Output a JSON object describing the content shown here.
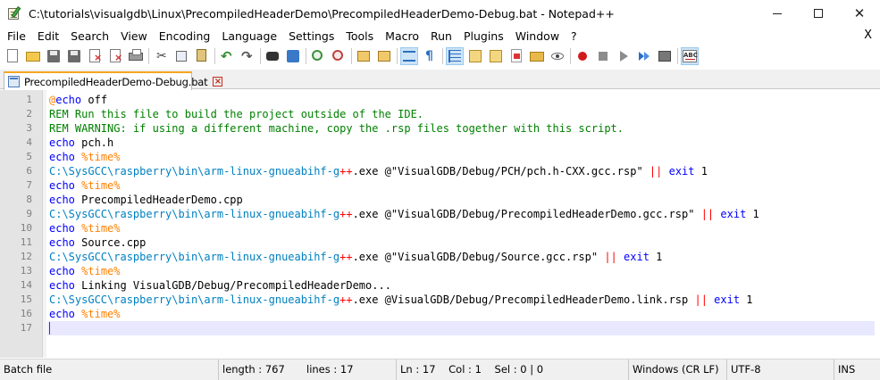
{
  "window": {
    "title": "C:\\tutorials\\visualgdb\\Linux\\PrecompiledHeaderDemo\\PrecompiledHeaderDemo-Debug.bat - Notepad++",
    "minimize": "",
    "close_glyph": "✕",
    "menu_close_glyph": "X"
  },
  "menu": [
    "File",
    "Edit",
    "Search",
    "View",
    "Encoding",
    "Language",
    "Settings",
    "Tools",
    "Macro",
    "Run",
    "Plugins",
    "Window",
    "?"
  ],
  "toolbar": {
    "icons": [
      "new-file-icon",
      "open-file-icon",
      "save-icon",
      "save-all-icon",
      "close-file-icon",
      "close-all-icon",
      "print-icon",
      "cut-icon",
      "copy-icon",
      "paste-icon",
      "undo-icon",
      "redo-icon",
      "find-icon",
      "replace-icon",
      "zoom-in-icon",
      "zoom-out-icon",
      "sync-vertical-icon",
      "sync-horizontal-icon",
      "word-wrap-icon",
      "show-all-characters-icon",
      "indent-guide-icon",
      "user-defined-language-icon",
      "document-map-icon",
      "function-list-icon",
      "folder-as-workspace-icon",
      "monitoring-icon",
      "record-macro-icon",
      "stop-recording-icon",
      "playback-macro-icon",
      "run-macro-multiple-icon",
      "save-macro-icon",
      "spell-check-icon"
    ],
    "abc_text": "ABC"
  },
  "tab": {
    "label": "PrecompiledHeaderDemo-Debug.bat",
    "close_glyph": "×"
  },
  "editor": {
    "line_numbers": [
      "1",
      "2",
      "3",
      "4",
      "5",
      "6",
      "7",
      "8",
      "9",
      "10",
      "11",
      "12",
      "13",
      "14",
      "15",
      "16",
      "17"
    ],
    "current_line": 17,
    "lines": [
      [
        {
          "c": "s-at",
          "t": "@"
        },
        {
          "c": "s-kw",
          "t": "echo"
        },
        {
          "c": "s-txt",
          "t": " off"
        }
      ],
      [
        {
          "c": "s-rem",
          "t": "REM Run this file to build the project outside of the IDE."
        }
      ],
      [
        {
          "c": "s-rem",
          "t": "REM WARNING: if using a different machine, copy the .rsp files together with this script."
        }
      ],
      [
        {
          "c": "s-kw",
          "t": "echo"
        },
        {
          "c": "s-txt",
          "t": " pch.h"
        }
      ],
      [
        {
          "c": "s-kw",
          "t": "echo"
        },
        {
          "c": "s-txt",
          "t": " "
        },
        {
          "c": "s-var",
          "t": "%time%"
        }
      ],
      [
        {
          "c": "s-path",
          "t": "C:\\SysGCC\\raspberry\\bin\\arm-linux-gnueabihf-g"
        },
        {
          "c": "s-op",
          "t": "++"
        },
        {
          "c": "s-txt",
          "t": ".exe @\"VisualGDB/Debug/PCH/pch.h-CXX.gcc.rsp\" "
        },
        {
          "c": "s-op",
          "t": "||"
        },
        {
          "c": "s-txt",
          "t": " "
        },
        {
          "c": "s-kw",
          "t": "exit"
        },
        {
          "c": "s-txt",
          "t": " 1"
        }
      ],
      [
        {
          "c": "s-kw",
          "t": "echo"
        },
        {
          "c": "s-txt",
          "t": " "
        },
        {
          "c": "s-var",
          "t": "%time%"
        }
      ],
      [
        {
          "c": "s-kw",
          "t": "echo"
        },
        {
          "c": "s-txt",
          "t": " PrecompiledHeaderDemo.cpp"
        }
      ],
      [
        {
          "c": "s-path",
          "t": "C:\\SysGCC\\raspberry\\bin\\arm-linux-gnueabihf-g"
        },
        {
          "c": "s-op",
          "t": "++"
        },
        {
          "c": "s-txt",
          "t": ".exe @\"VisualGDB/Debug/PrecompiledHeaderDemo.gcc.rsp\" "
        },
        {
          "c": "s-op",
          "t": "||"
        },
        {
          "c": "s-txt",
          "t": " "
        },
        {
          "c": "s-kw",
          "t": "exit"
        },
        {
          "c": "s-txt",
          "t": " 1"
        }
      ],
      [
        {
          "c": "s-kw",
          "t": "echo"
        },
        {
          "c": "s-txt",
          "t": " "
        },
        {
          "c": "s-var",
          "t": "%time%"
        }
      ],
      [
        {
          "c": "s-kw",
          "t": "echo"
        },
        {
          "c": "s-txt",
          "t": " Source.cpp"
        }
      ],
      [
        {
          "c": "s-path",
          "t": "C:\\SysGCC\\raspberry\\bin\\arm-linux-gnueabihf-g"
        },
        {
          "c": "s-op",
          "t": "++"
        },
        {
          "c": "s-txt",
          "t": ".exe @\"VisualGDB/Debug/Source.gcc.rsp\" "
        },
        {
          "c": "s-op",
          "t": "||"
        },
        {
          "c": "s-txt",
          "t": " "
        },
        {
          "c": "s-kw",
          "t": "exit"
        },
        {
          "c": "s-txt",
          "t": " 1"
        }
      ],
      [
        {
          "c": "s-kw",
          "t": "echo"
        },
        {
          "c": "s-txt",
          "t": " "
        },
        {
          "c": "s-var",
          "t": "%time%"
        }
      ],
      [
        {
          "c": "s-kw",
          "t": "echo"
        },
        {
          "c": "s-txt",
          "t": " Linking VisualGDB/Debug/PrecompiledHeaderDemo..."
        }
      ],
      [
        {
          "c": "s-path",
          "t": "C:\\SysGCC\\raspberry\\bin\\arm-linux-gnueabihf-g"
        },
        {
          "c": "s-op",
          "t": "++"
        },
        {
          "c": "s-txt",
          "t": ".exe @VisualGDB/Debug/PrecompiledHeaderDemo.link.rsp "
        },
        {
          "c": "s-op",
          "t": "||"
        },
        {
          "c": "s-txt",
          "t": " "
        },
        {
          "c": "s-kw",
          "t": "exit"
        },
        {
          "c": "s-txt",
          "t": " 1"
        }
      ],
      [
        {
          "c": "s-kw",
          "t": "echo"
        },
        {
          "c": "s-txt",
          "t": " "
        },
        {
          "c": "s-var",
          "t": "%time%"
        }
      ],
      []
    ]
  },
  "status": {
    "language": "Batch file",
    "length": "length : 767",
    "lines": "lines : 17",
    "position": "Ln : 17    Col : 1    Sel : 0 | 0",
    "eol": "Windows (CR LF)",
    "encoding": "UTF-8",
    "mode": "INS"
  },
  "colors": {
    "keyword": "#0000ff",
    "comment": "#008000",
    "variable": "#ff8000",
    "path": "#0080c0",
    "operator": "#ff0000",
    "current_line": "#e8e8ff",
    "tab_accent": "#f5a623"
  }
}
